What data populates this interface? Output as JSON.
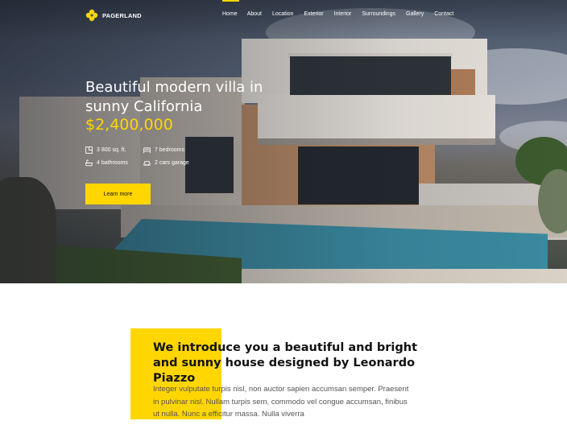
{
  "brand": {
    "name": "PAGERLAND",
    "accent": "#ffd600"
  },
  "nav": {
    "items": [
      "Home",
      "About",
      "Location",
      "Exterior",
      "Interior",
      "Surroundings",
      "Gallery",
      "Contact"
    ],
    "active": "Home"
  },
  "hero": {
    "title": "Beautiful modern villa in sunny California",
    "price": "$2,400,000",
    "features": {
      "area": {
        "icon": "floorplan-icon",
        "text": "3 800 sq. ft."
      },
      "bedrooms": {
        "icon": "bed-icon",
        "text": "7 bedrooms"
      },
      "bathrooms": {
        "icon": "bathtub-icon",
        "text": "4 bathrooms"
      },
      "garage": {
        "icon": "car-icon",
        "text": "2 cars garage"
      }
    },
    "cta_label": "Learn more"
  },
  "intro": {
    "title": "We introduce you a beautiful and bright and sunny house designed by Leonardo Piazzo",
    "body": "Integer vulputate turpis nisl, non auctor sapien accumsan semper. Praesent in pulvinar nisl. Nullam turpis sem, commodo vel congue accumsan, finibus ut nulla. Nunc a efficitur massa. Nulla viverra"
  }
}
